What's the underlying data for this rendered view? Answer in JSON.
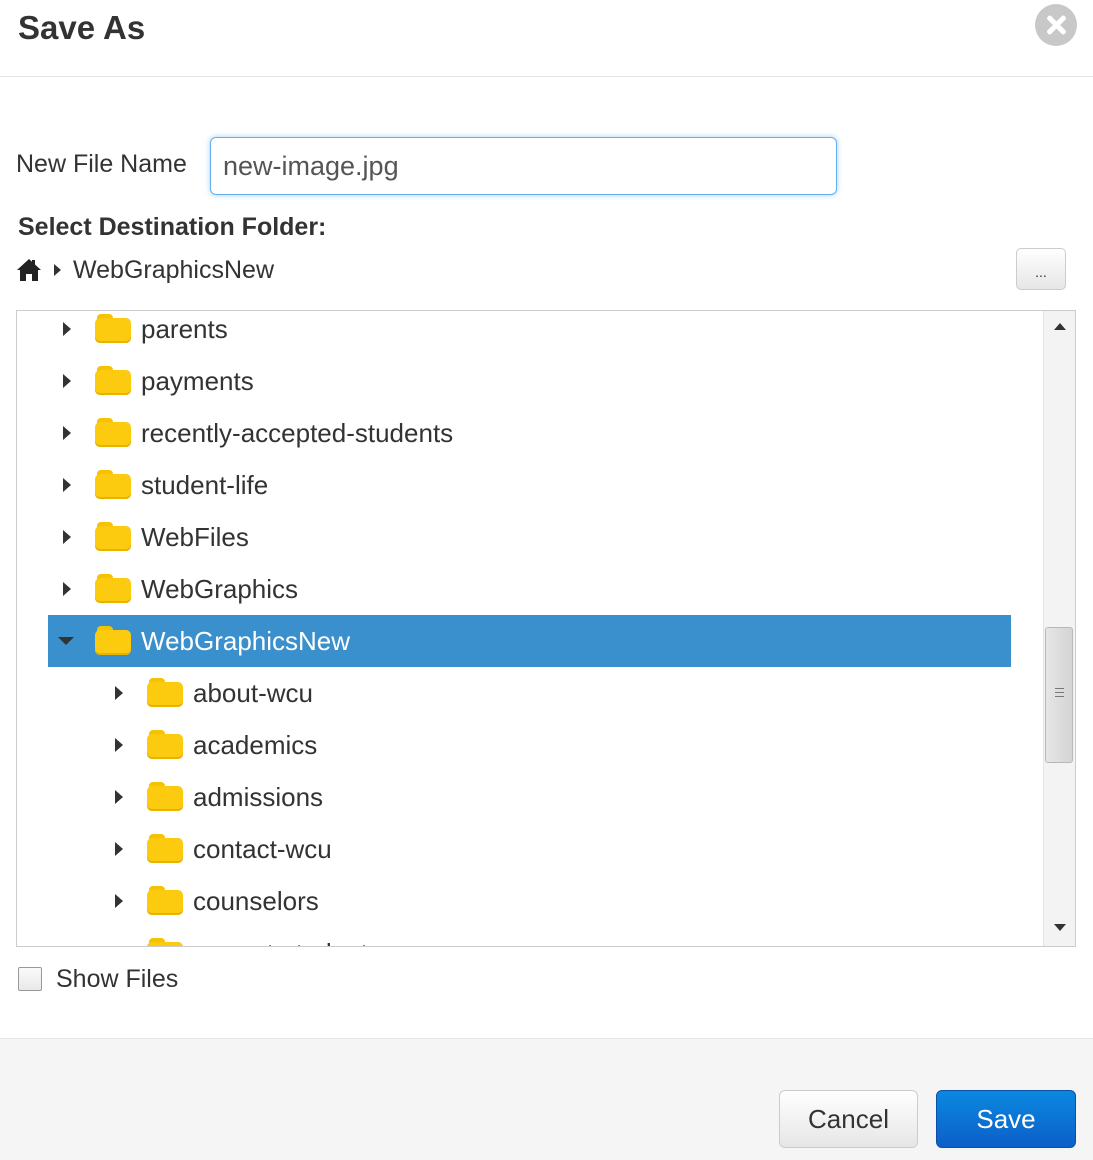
{
  "dialog": {
    "title": "Save As",
    "close_icon": "close-circle-icon"
  },
  "form": {
    "filename_label": "New File Name",
    "filename_value": "new-image.jpg",
    "destination_label": "Select Destination Folder:"
  },
  "breadcrumb": {
    "home_icon": "home-icon",
    "current": "WebGraphicsNew",
    "more_label": "..."
  },
  "tree": {
    "items": [
      {
        "label": "parents",
        "level": 0,
        "expanded": false,
        "selected": false
      },
      {
        "label": "payments",
        "level": 0,
        "expanded": false,
        "selected": false
      },
      {
        "label": "recently-accepted-students",
        "level": 0,
        "expanded": false,
        "selected": false
      },
      {
        "label": "student-life",
        "level": 0,
        "expanded": false,
        "selected": false
      },
      {
        "label": "WebFiles",
        "level": 0,
        "expanded": false,
        "selected": false
      },
      {
        "label": "WebGraphics",
        "level": 0,
        "expanded": false,
        "selected": false
      },
      {
        "label": "WebGraphicsNew",
        "level": 0,
        "expanded": true,
        "selected": true
      },
      {
        "label": "about-wcu",
        "level": 1,
        "expanded": false,
        "selected": false
      },
      {
        "label": "academics",
        "level": 1,
        "expanded": false,
        "selected": false
      },
      {
        "label": "admissions",
        "level": 1,
        "expanded": false,
        "selected": false
      },
      {
        "label": "contact-wcu",
        "level": 1,
        "expanded": false,
        "selected": false
      },
      {
        "label": "counselors",
        "level": 1,
        "expanded": false,
        "selected": false
      },
      {
        "label": "current-students",
        "level": 1,
        "expanded": false,
        "selected": false
      }
    ],
    "selected_color": "#3a8fcd",
    "folder_color": "#fccb10"
  },
  "options": {
    "show_files_label": "Show Files",
    "show_files_checked": false
  },
  "footer": {
    "cancel_label": "Cancel",
    "save_label": "Save",
    "primary_color": "#0d6fd6"
  }
}
